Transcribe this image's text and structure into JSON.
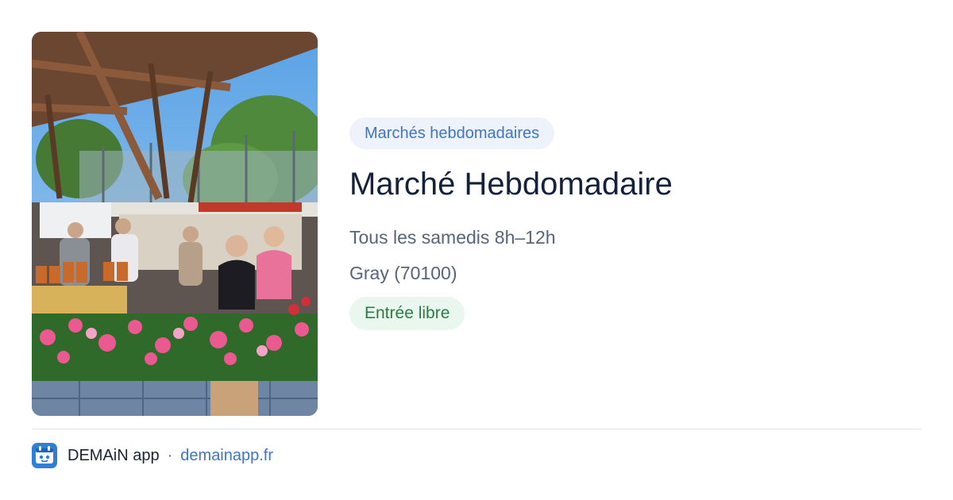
{
  "event": {
    "category": "Marchés hebdomadaires",
    "title": "Marché Hebdomadaire",
    "schedule": "Tous les samedis 8h–12h",
    "location": "Gray (70100)",
    "price": "Entrée libre"
  },
  "footer": {
    "app_name": "DEMAiN app",
    "separator": "·",
    "url": "demainapp.fr"
  },
  "icons": {
    "app": "demain-app-logo-icon"
  },
  "colors": {
    "category_bg": "#eef3fb",
    "category_text": "#3f74c8",
    "title": "#14213a",
    "muted_text": "#56657a",
    "price_bg": "#eaf7ee",
    "price_text": "#2e7b44",
    "link": "#3f74c8"
  }
}
